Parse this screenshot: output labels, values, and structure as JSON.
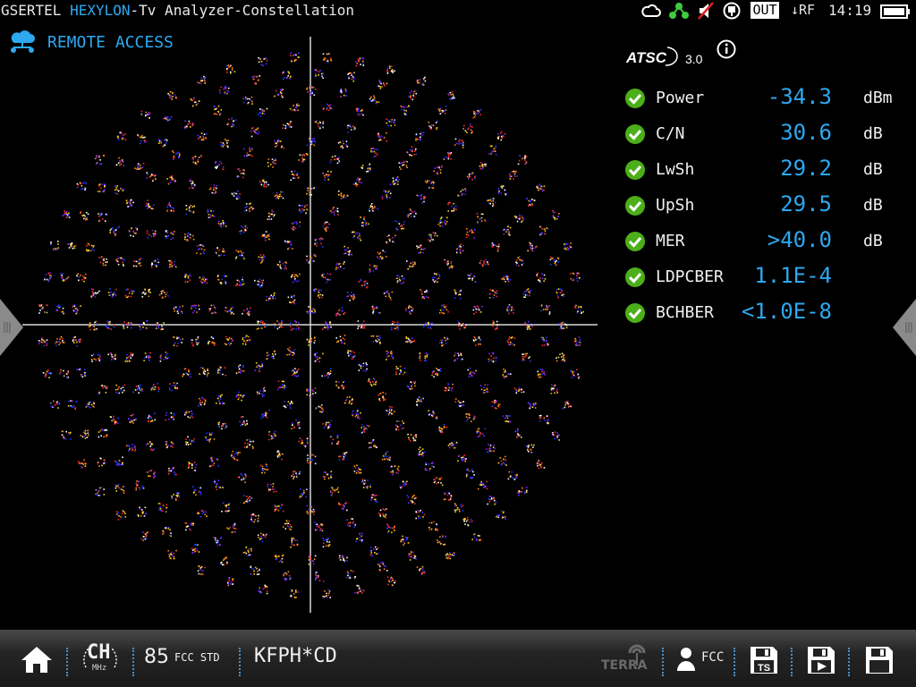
{
  "header": {
    "vendor": "GSERTEL",
    "product": "HEXYLON",
    "separator": "-",
    "title": "Tv Analyzer-Constellation",
    "out_label": "OUT",
    "rf_label": "↓RF",
    "time": "14:19",
    "icons": [
      "cloud-icon",
      "network-icon",
      "speaker-muted-icon",
      "power-plug-icon",
      "battery-icon"
    ]
  },
  "remote": {
    "label": "REMOTE ACCESS",
    "icon": "cloud-network-icon"
  },
  "standard": {
    "logo_text": "ATSC",
    "logo_version": "3.0",
    "info_icon": "info-icon"
  },
  "measurements": [
    {
      "name": "Power",
      "value": "-34.3",
      "unit": "dBm",
      "status": "ok"
    },
    {
      "name": "C/N",
      "value": "30.6",
      "unit": "dB",
      "status": "ok"
    },
    {
      "name": "LwSh",
      "value": "29.2",
      "unit": "dB",
      "status": "ok"
    },
    {
      "name": "UpSh",
      "value": "29.5",
      "unit": "dB",
      "status": "ok"
    },
    {
      "name": "MER",
      "value": ">40.0",
      "unit": "dB",
      "status": "ok"
    },
    {
      "name": "LDPCBER",
      "value": "1.1E-4",
      "unit": "",
      "status": "ok"
    },
    {
      "name": "BCHBER",
      "value": "<1.0E-8",
      "unit": "",
      "status": "ok"
    }
  ],
  "constellation": {
    "modulation_rings": 16,
    "axes": true,
    "point_colors": [
      "#1a3cff",
      "#ff2a2a",
      "#ffd21a",
      "#ffffff",
      "#ff8a1a",
      "#6a2aff"
    ]
  },
  "bottom": {
    "home_icon": "home-icon",
    "ch_label": "CH",
    "mhz_label": "MHz",
    "channel": "85",
    "channel_plan": "FCC STD",
    "station": "KFPH*CD",
    "terra_label": "TERRA",
    "user_label": "FCC",
    "ts_label": "TS",
    "buttons": [
      "save-ts-button",
      "save-play-button",
      "save-button"
    ]
  },
  "colors": {
    "accent": "#2ea8f0",
    "ok": "#4caf1a",
    "background": "#000000"
  }
}
